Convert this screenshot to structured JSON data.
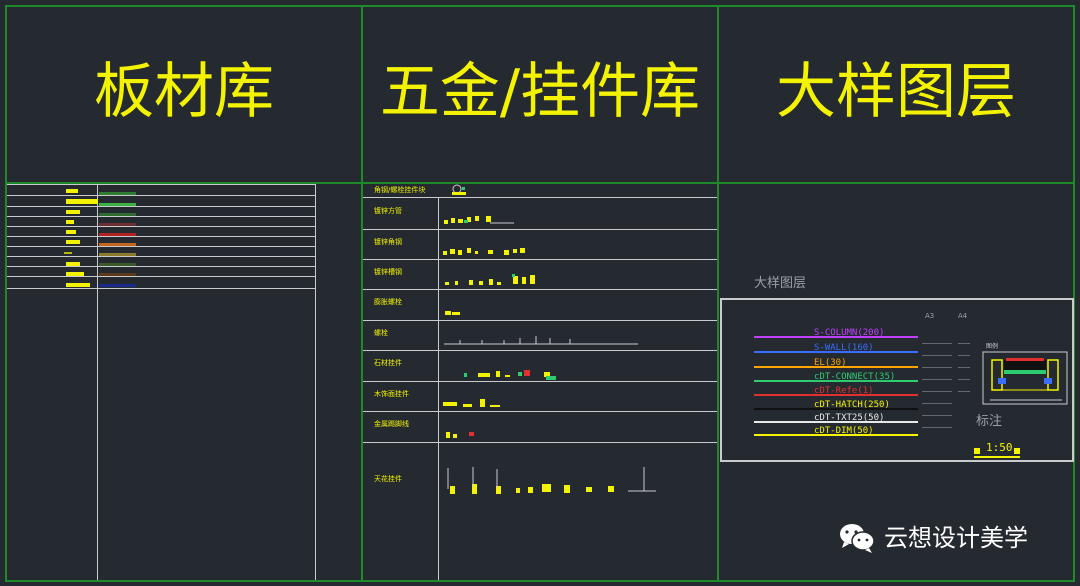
{
  "titles": {
    "panel_sheet": "板材库",
    "panel_hardware": "五金/挂件库",
    "panel_detail": "大样图层"
  },
  "hardware": {
    "rows": [
      "角钢/螺栓挂件块",
      "镀锌方管",
      "镀锌角钢",
      "镀锌槽钢",
      "膨胀螺栓",
      "螺栓",
      "石材挂件",
      "木饰面挂件",
      "金属踢脚线",
      "天花挂件"
    ]
  },
  "detail": {
    "header": "大样图层",
    "layers": [
      {
        "label": "S-COLUMN(200)",
        "color": "#c040ff"
      },
      {
        "label": "S-WALL(160)",
        "color": "#3a6cff"
      },
      {
        "label": "EL(30)",
        "color": "#ffa500"
      },
      {
        "label": "cDT-CONNECT(35)",
        "color": "#2ecc71"
      },
      {
        "label": "cDT-Refe(1)",
        "color": "#e03030"
      },
      {
        "label": "cDT-HATCH(250)",
        "color": "#111111"
      },
      {
        "label": "cDT-TXT25(50)",
        "color": "#e8e8e8"
      },
      {
        "label": "cDT-DIM(50)",
        "color": "#f3f300"
      }
    ],
    "annotation_label": "标注",
    "scale_text": "1:50"
  },
  "watermark": {
    "text": "云想设计美学"
  },
  "colors": {
    "background": "#252a31",
    "frame": "#1f8a2a",
    "title": "#f3f300"
  }
}
